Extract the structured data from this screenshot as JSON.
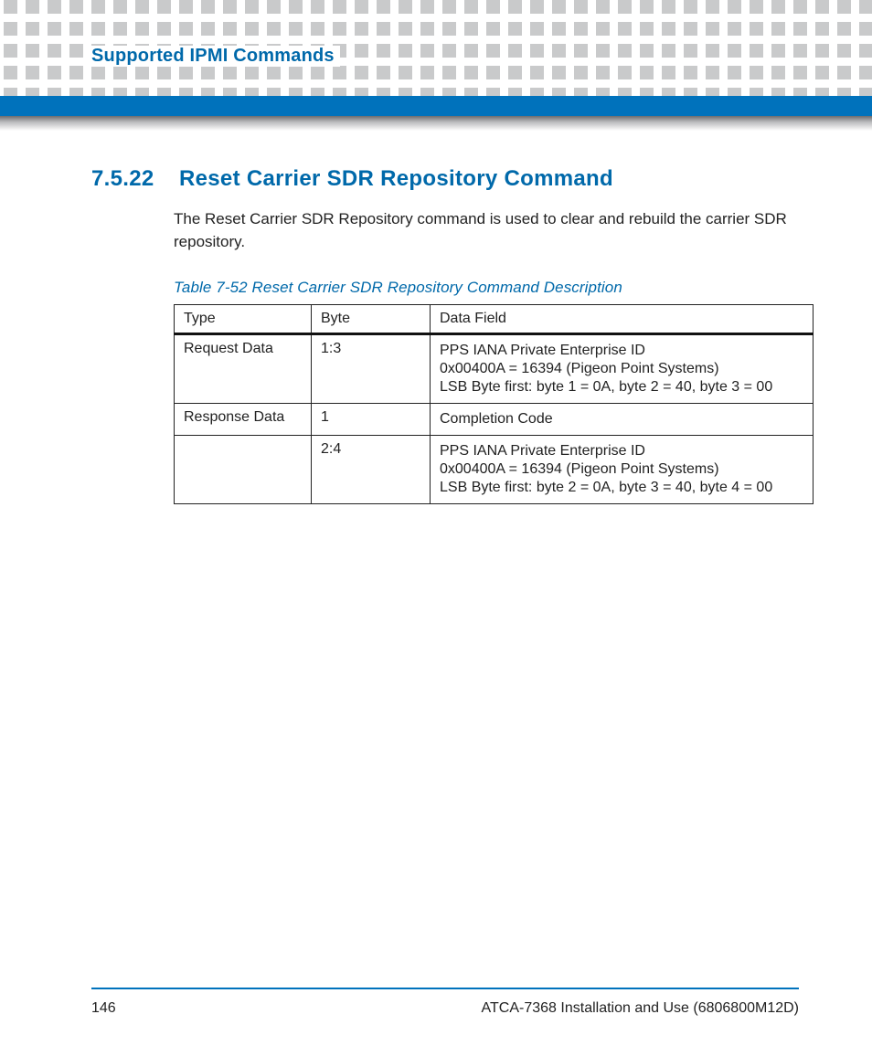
{
  "header": {
    "chapter_title": "Supported IPMI Commands"
  },
  "section": {
    "number": "7.5.22",
    "title": "Reset Carrier SDR Repository Command",
    "body": "The Reset Carrier SDR Repository command is used to clear and rebuild the carrier SDR repository."
  },
  "table": {
    "caption": "Table 7-52 Reset Carrier SDR Repository Command Description",
    "columns": [
      "Type",
      "Byte",
      "Data Field"
    ],
    "rows": [
      {
        "type": "Request Data",
        "byte": "1:3",
        "data_lines": [
          "PPS IANA Private Enterprise ID",
          "0x00400A = 16394 (Pigeon Point Systems)",
          "LSB Byte first: byte 1 = 0A, byte 2 = 40, byte 3 = 00"
        ]
      },
      {
        "type": "Response Data",
        "byte": "1",
        "data_lines": [
          "Completion Code"
        ]
      },
      {
        "type": "",
        "byte": "2:4",
        "data_lines": [
          "PPS IANA Private Enterprise ID",
          "0x00400A = 16394 (Pigeon Point Systems)",
          "LSB Byte first: byte 2 = 0A, byte 3 = 40, byte 4 = 00"
        ]
      }
    ]
  },
  "footer": {
    "page_number": "146",
    "doc_ref": "ATCA-7368 Installation and Use (6806800M12D)"
  }
}
